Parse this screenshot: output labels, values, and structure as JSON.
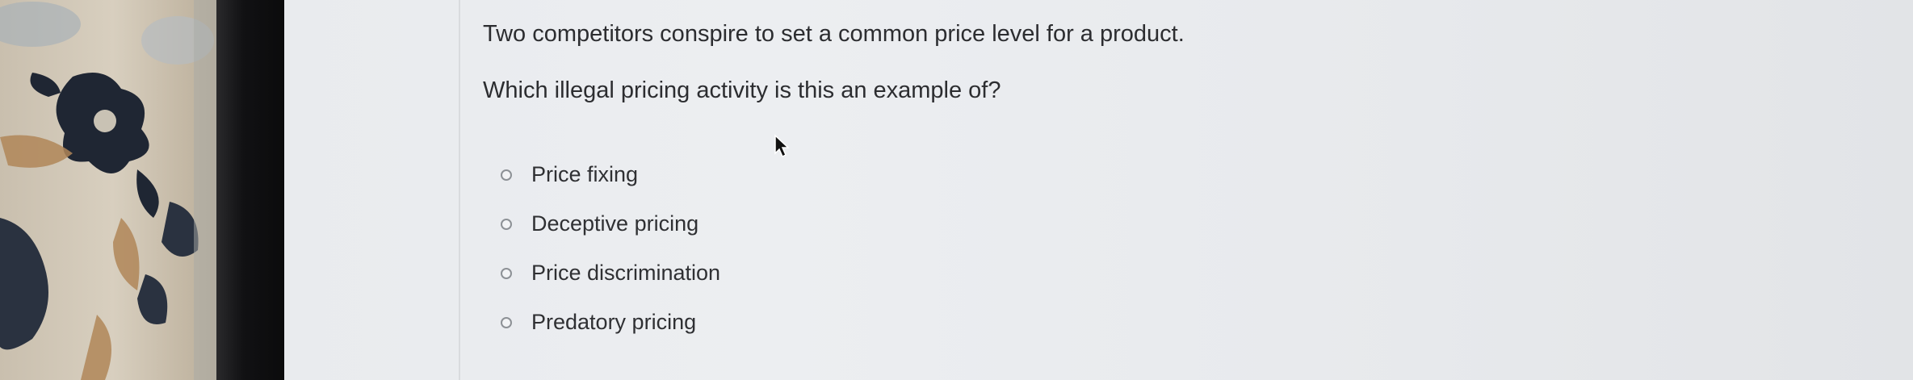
{
  "question": {
    "line1": "Two competitors conspire to set a common price level for a product.",
    "line2": "Which illegal pricing activity is this an example of?"
  },
  "options": [
    {
      "label": "Price fixing",
      "selected": false
    },
    {
      "label": "Deceptive pricing",
      "selected": false
    },
    {
      "label": "Price discrimination",
      "selected": false
    },
    {
      "label": "Predatory pricing",
      "selected": false
    }
  ],
  "colors": {
    "screen_background": "#e9ebee",
    "text": "#2c2d30",
    "radio_border": "#8d9196",
    "bezel": "#111113"
  },
  "icons": {
    "pointer": "mouse-pointer-icon",
    "radio": "radio-unchecked-icon"
  }
}
